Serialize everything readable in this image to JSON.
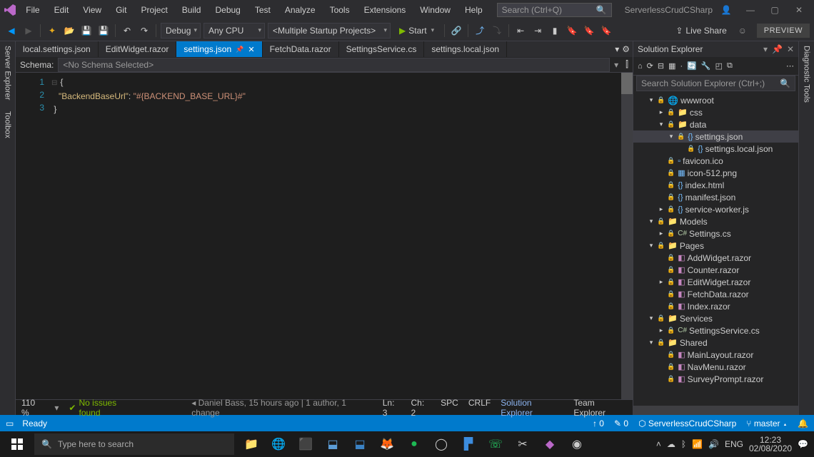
{
  "title": {
    "solution": "ServerlessCrudCSharp"
  },
  "menu": [
    "File",
    "Edit",
    "View",
    "Git",
    "Project",
    "Build",
    "Debug",
    "Test",
    "Analyze",
    "Tools",
    "Extensions",
    "Window",
    "Help"
  ],
  "search_placeholder": "Search (Ctrl+Q)",
  "toolbar": {
    "config": "Debug",
    "platform": "Any CPU",
    "startup": "<Multiple Startup Projects>",
    "start": "Start",
    "liveshare": "Live Share",
    "preview": "PREVIEW"
  },
  "left_tabs": [
    "Server Explorer",
    "Toolbox"
  ],
  "right_tabs": [
    "Diagnostic Tools"
  ],
  "editor_tabs": [
    {
      "label": "local.settings.json",
      "active": false
    },
    {
      "label": "EditWidget.razor",
      "active": false
    },
    {
      "label": "settings.json",
      "active": true
    },
    {
      "label": "FetchData.razor",
      "active": false
    },
    {
      "label": "SettingsService.cs",
      "active": false
    },
    {
      "label": "settings.local.json",
      "active": false
    }
  ],
  "schema": {
    "label": "Schema:",
    "value": "<No Schema Selected>"
  },
  "code": {
    "lines": [
      "1",
      "2",
      "3"
    ],
    "l1": "{",
    "l2_key": "\"BackendBaseUrl\"",
    "l2_colon": ": ",
    "l2_val": "\"#{BACKEND_BASE_URL}#\"",
    "l3": "}"
  },
  "estatus": {
    "zoom": "110 %",
    "noissues": "No issues found",
    "blame": "Daniel Bass, 15 hours ago | 1 author, 1 change",
    "ln": "Ln: 3",
    "ch": "Ch: 2",
    "spc": "SPC",
    "crlf": "CRLF",
    "se": "Solution Explorer",
    "te": "Team Explorer"
  },
  "se": {
    "title": "Solution Explorer",
    "search": "Search Solution Explorer (Ctrl+;)",
    "tree": [
      {
        "d": 1,
        "a": "▾",
        "i": "globe",
        "t": "wwwroot"
      },
      {
        "d": 2,
        "a": "▸",
        "i": "folder",
        "t": "css"
      },
      {
        "d": 2,
        "a": "▾",
        "i": "folder",
        "t": "data"
      },
      {
        "d": 3,
        "a": "▾",
        "i": "json",
        "t": "settings.json",
        "sel": true
      },
      {
        "d": 4,
        "a": "",
        "i": "json",
        "t": "settings.local.json"
      },
      {
        "d": 2,
        "a": "",
        "i": "file",
        "t": "favicon.ico"
      },
      {
        "d": 2,
        "a": "",
        "i": "img",
        "t": "icon-512.png"
      },
      {
        "d": 2,
        "a": "",
        "i": "json",
        "t": "index.html"
      },
      {
        "d": 2,
        "a": "",
        "i": "json",
        "t": "manifest.json"
      },
      {
        "d": 2,
        "a": "▸",
        "i": "json",
        "t": "service-worker.js"
      },
      {
        "d": 1,
        "a": "▾",
        "i": "folder",
        "t": "Models"
      },
      {
        "d": 2,
        "a": "▸",
        "i": "cs",
        "t": "Settings.cs"
      },
      {
        "d": 1,
        "a": "▾",
        "i": "folder",
        "t": "Pages"
      },
      {
        "d": 2,
        "a": "",
        "i": "raz",
        "t": "AddWidget.razor"
      },
      {
        "d": 2,
        "a": "",
        "i": "raz",
        "t": "Counter.razor"
      },
      {
        "d": 2,
        "a": "▸",
        "i": "raz",
        "t": "EditWidget.razor"
      },
      {
        "d": 2,
        "a": "",
        "i": "raz",
        "t": "FetchData.razor"
      },
      {
        "d": 2,
        "a": "",
        "i": "raz",
        "t": "Index.razor"
      },
      {
        "d": 1,
        "a": "▾",
        "i": "folder",
        "t": "Services"
      },
      {
        "d": 2,
        "a": "▸",
        "i": "cs",
        "t": "SettingsService.cs"
      },
      {
        "d": 1,
        "a": "▾",
        "i": "folder",
        "t": "Shared"
      },
      {
        "d": 2,
        "a": "",
        "i": "raz",
        "t": "MainLayout.razor"
      },
      {
        "d": 2,
        "a": "",
        "i": "raz",
        "t": "NavMenu.razor"
      },
      {
        "d": 2,
        "a": "",
        "i": "raz",
        "t": "SurveyPrompt.razor"
      }
    ]
  },
  "bluebar": {
    "ready": "Ready",
    "up": "0",
    "pen": "0",
    "repo": "ServerlessCrudCSharp",
    "branch": "master"
  },
  "taskbar": {
    "search": "Type here to search",
    "lang": "ENG",
    "time": "12:23",
    "date": "02/08/2020"
  }
}
